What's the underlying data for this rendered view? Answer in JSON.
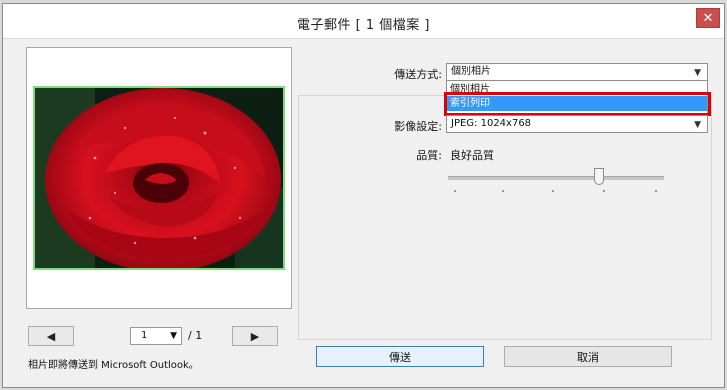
{
  "window": {
    "title": "電子郵件 [ 1 個檔案 ]",
    "close_symbol": "✕"
  },
  "settings": {
    "send_method_label": "傳送方式:",
    "send_method_value": "個別相片",
    "send_method_options": [
      "個別相片",
      "索引列印"
    ],
    "send_method_highlighted": "索引列印",
    "image_settings_label": "影像設定:",
    "image_settings_value": "JPEG: 1024x768",
    "quality_label": "品質:",
    "quality_value": "良好品質",
    "quality_slider_level": 0.7
  },
  "pager": {
    "prev_symbol": "◀",
    "next_symbol": "▶",
    "current_page": "1",
    "total_text": "/ 1"
  },
  "status": {
    "message": "相片即將傳送到 Microsoft Outlook。"
  },
  "buttons": {
    "send_label": "傳送",
    "cancel_label": "取消"
  },
  "colors": {
    "accent_selection": "#3399ff",
    "highlight_box": "#e00000",
    "photo_frame": "#7edc7e",
    "close_button": "#c94f4f"
  }
}
